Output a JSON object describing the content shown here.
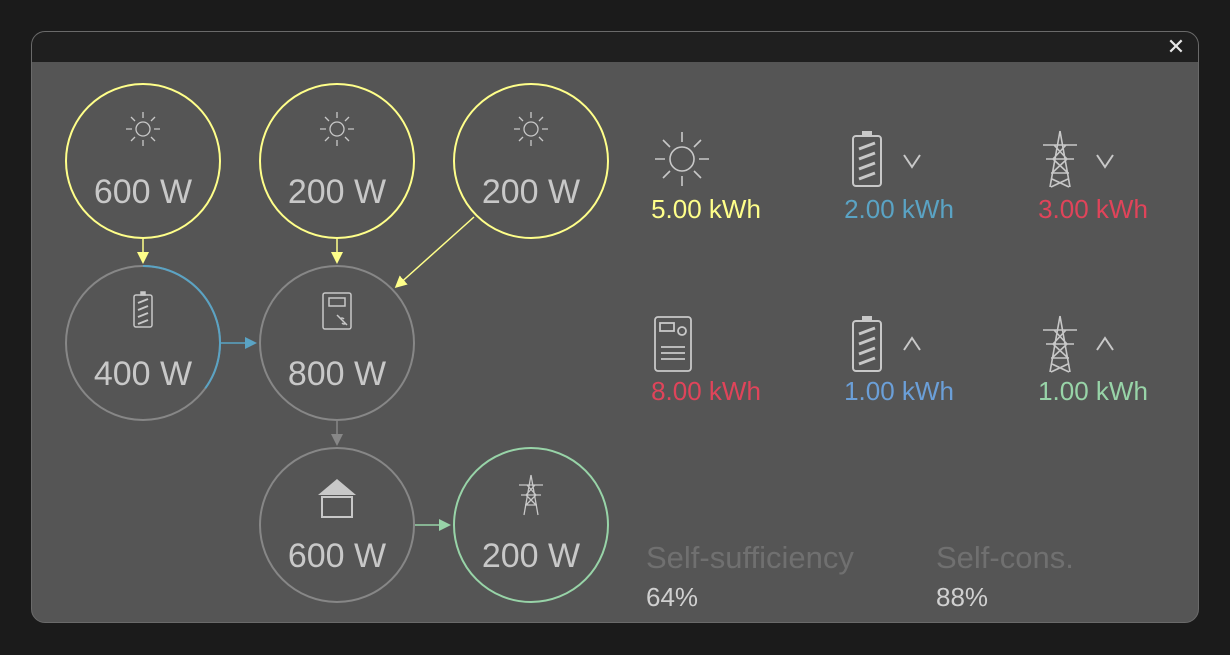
{
  "window": {
    "close_glyph": "✕"
  },
  "colors": {
    "solar": "#ffff8a",
    "battery": "#5aa3c4",
    "battery_charge": "#6b9fd8",
    "grid_import": "#e0445a",
    "grid_export": "#98d4a8",
    "neutral": "#878787",
    "text": "#c8c8c8"
  },
  "flow": {
    "solar_1": {
      "icon": "sun-icon",
      "value": "600 W"
    },
    "solar_2": {
      "icon": "sun-icon",
      "value": "200 W"
    },
    "solar_3": {
      "icon": "sun-icon",
      "value": "200 W"
    },
    "battery": {
      "icon": "battery-icon",
      "value": "400 W",
      "charge_level": 0.35
    },
    "inverter": {
      "icon": "inverter-icon",
      "value": "800 W"
    },
    "home": {
      "icon": "house-icon",
      "value": "600 W"
    },
    "grid": {
      "icon": "pylon-icon",
      "value": "200 W"
    }
  },
  "stats": {
    "solar_energy": {
      "icon": "sun-icon",
      "value": "5.00 kWh"
    },
    "battery_discharge": {
      "icon": "battery-icon",
      "direction": "down-chevron-icon",
      "value": "2.00 kWh"
    },
    "grid_import": {
      "icon": "pylon-icon",
      "direction": "down-chevron-icon",
      "value": "3.00 kWh"
    },
    "meter": {
      "icon": "meter-icon",
      "value": "8.00 kWh"
    },
    "battery_charge": {
      "icon": "battery-icon",
      "direction": "up-chevron-icon",
      "value": "1.00 kWh"
    },
    "grid_export": {
      "icon": "pylon-icon",
      "direction": "up-chevron-icon",
      "value": "1.00 kWh"
    }
  },
  "ratios": {
    "self_sufficiency": {
      "label": "Self-sufficiency",
      "value": "64%"
    },
    "self_consumption": {
      "label": "Self-cons.",
      "value": "88%"
    }
  }
}
